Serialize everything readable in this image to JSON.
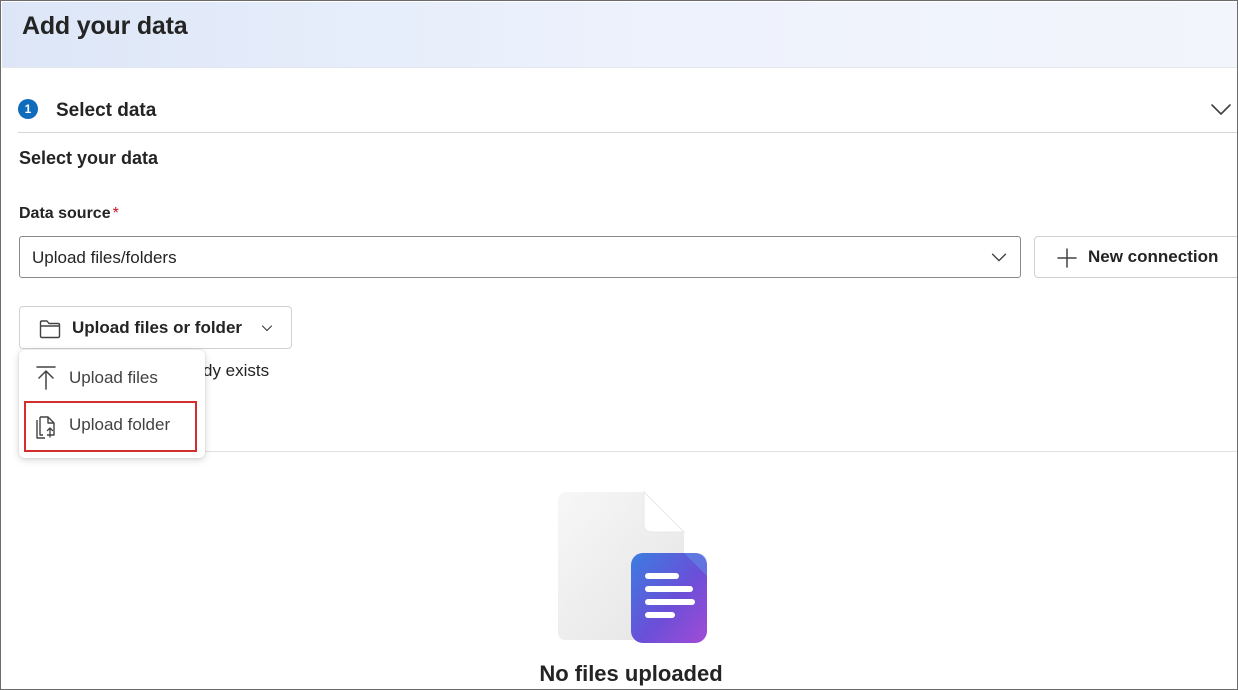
{
  "header": {
    "title": "Add your data"
  },
  "step": {
    "number": "1",
    "title": "Select data"
  },
  "section": {
    "title": "Select your data"
  },
  "data_source": {
    "label": "Data source",
    "required_marker": "*",
    "selected_value": "Upload files/folders"
  },
  "new_connection": {
    "label": "New connection",
    "icon": "plus-icon"
  },
  "upload_button": {
    "label": "Upload files or folder",
    "icon": "folder-icon"
  },
  "partially_hidden_text": "dy exists",
  "upload_menu": {
    "items": [
      {
        "label": "Upload files",
        "icon": "arrow-upload-icon"
      },
      {
        "label": "Upload folder",
        "icon": "document-upload-icon",
        "highlighted": true
      }
    ]
  },
  "empty_state": {
    "message": "No files uploaded",
    "icon": "document-illustration"
  },
  "colors": {
    "accent": "#0f6cbd",
    "required": "#c50f1f",
    "highlight": "#d32f2f",
    "header_gradient_start": "#dde6f7",
    "header_gradient_end": "#f3f5fc"
  }
}
